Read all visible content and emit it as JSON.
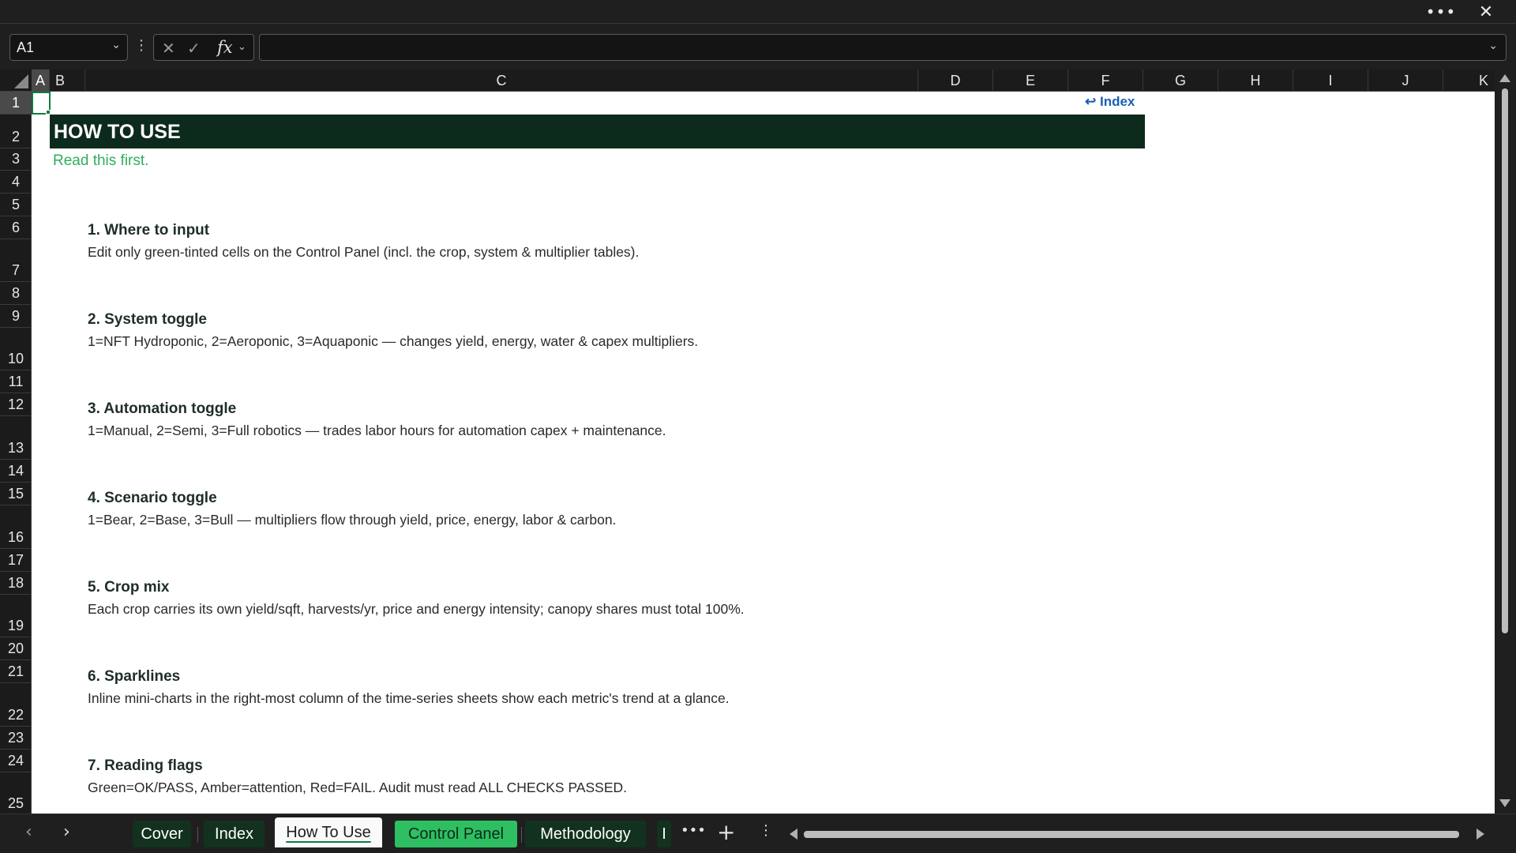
{
  "titlebar": {
    "more_icon": "ellipsis-icon",
    "close_icon": "close-icon"
  },
  "formula_bar": {
    "name_box": "A1",
    "formula": ""
  },
  "columns": [
    "A",
    "B",
    "C",
    "D",
    "E",
    "F",
    "G",
    "H",
    "I",
    "J",
    "K"
  ],
  "selected_column": "A",
  "rows": [
    "1",
    "2",
    "3",
    "4",
    "5",
    "6",
    "7",
    "8",
    "9",
    "10",
    "11",
    "12",
    "13",
    "14",
    "15",
    "16",
    "17",
    "18",
    "19",
    "20",
    "21",
    "22",
    "23",
    "24",
    "25"
  ],
  "selected_row": "1",
  "sheet": {
    "index_link": "↩ Index",
    "banner": "HOW TO USE",
    "subtitle": "Read this first.",
    "sections": [
      {
        "title": "1. Where to input",
        "desc": "Edit only green-tinted cells on the Control Panel (incl. the crop, system & multiplier tables)."
      },
      {
        "title": "2. System toggle",
        "desc": "1=NFT Hydroponic, 2=Aeroponic, 3=Aquaponic — changes yield, energy, water & capex multipliers."
      },
      {
        "title": "3. Automation toggle",
        "desc": "1=Manual, 2=Semi, 3=Full robotics — trades labor hours for automation capex + maintenance."
      },
      {
        "title": "4. Scenario toggle",
        "desc": "1=Bear, 2=Base, 3=Bull — multipliers flow through yield, price, energy, labor & carbon."
      },
      {
        "title": "5. Crop mix",
        "desc": "Each crop carries its own yield/sqft, harvests/yr, price and energy intensity; canopy shares must total 100%."
      },
      {
        "title": "6. Sparklines",
        "desc": "Inline mini-charts in the right-most column of the time-series sheets show each metric's trend at a glance."
      },
      {
        "title": "7. Reading flags",
        "desc": "Green=OK/PASS, Amber=attention, Red=FAIL. Audit must read ALL CHECKS PASSED."
      }
    ]
  },
  "tabs": {
    "cover": "Cover",
    "index": "Index",
    "how_to_use": "How To Use",
    "control_panel": "Control Panel",
    "methodology": "Methodology",
    "partial": "I",
    "active": "How To Use"
  },
  "colors": {
    "banner_bg": "#0d2b1c",
    "subtitle": "#2fae5e",
    "link": "#1a5fb4",
    "control_panel_tab": "#2dbf62",
    "dark_tab": "#12321f",
    "selection": "#107c41"
  }
}
